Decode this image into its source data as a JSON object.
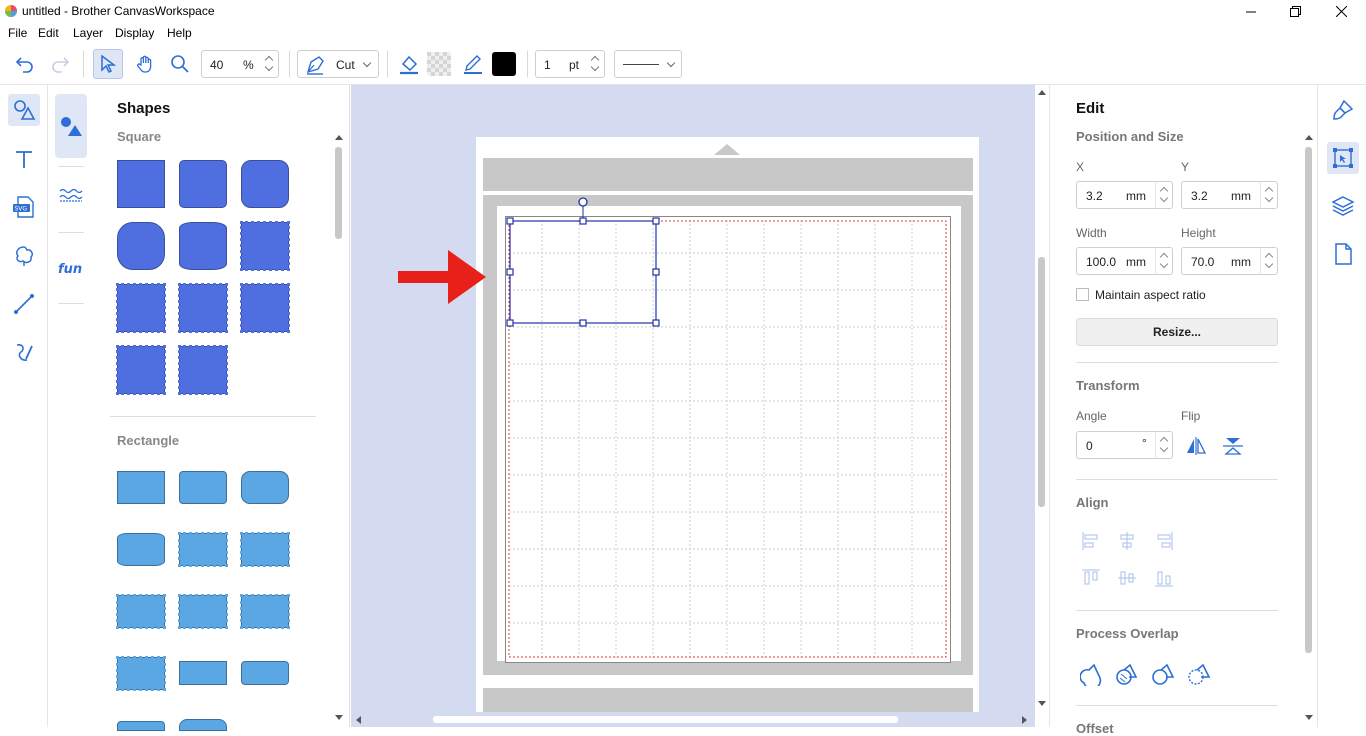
{
  "window": {
    "title": "untitled - Brother CanvasWorkspace"
  },
  "menu": [
    "File",
    "Edit",
    "Layer",
    "Display",
    "Help"
  ],
  "toolbar": {
    "zoom_value": "40",
    "zoom_unit": "%",
    "line_type": "Cut",
    "stroke_width": "1",
    "stroke_unit": "pt",
    "line_color": "#000000"
  },
  "shapes_panel": {
    "title": "Shapes",
    "sections": [
      "Square",
      "Rectangle"
    ]
  },
  "edit_panel": {
    "title": "Edit",
    "position_size": "Position and Size",
    "x_label": "X",
    "x_value": "3.2",
    "x_unit": "mm",
    "y_label": "Y",
    "y_value": "3.2",
    "y_unit": "mm",
    "width_label": "Width",
    "width_value": "100.0",
    "width_unit": "mm",
    "height_label": "Height",
    "height_value": "70.0",
    "height_unit": "mm",
    "maintain_aspect": "Maintain aspect ratio",
    "resize_button": "Resize...",
    "transform": "Transform",
    "angle_label": "Angle",
    "angle_value": "0",
    "angle_unit": "°",
    "flip_label": "Flip",
    "align": "Align",
    "process_overlap": "Process Overlap",
    "offset": "Offset"
  },
  "colors": {
    "accent": "#2d6fd6",
    "canvas_bg": "#d4dbf1",
    "shape_square": "#4f6fe0",
    "shape_rect": "#5aa7e4",
    "annotation_arrow": "#e8201a"
  }
}
